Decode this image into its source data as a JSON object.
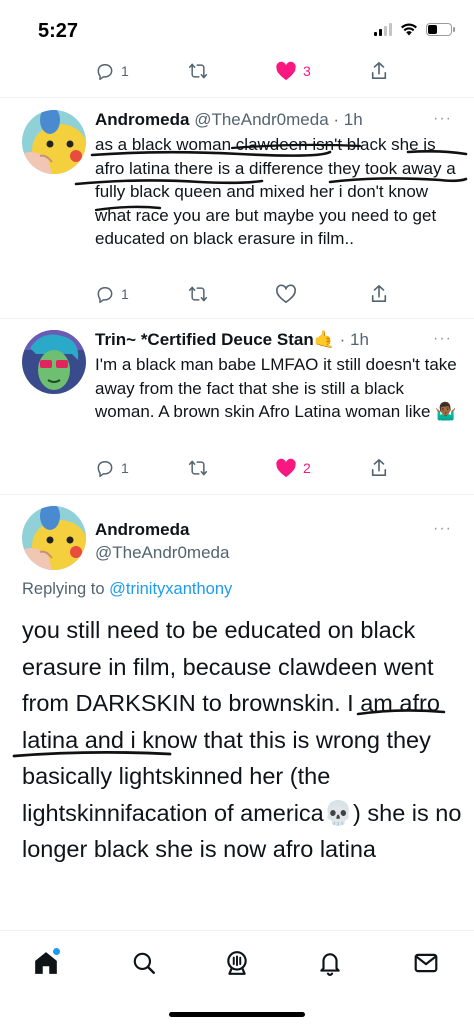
{
  "status_bar": {
    "time": "5:27",
    "icons": [
      "signal-icon",
      "wifi-icon",
      "battery-icon"
    ],
    "battery_level": 0.45
  },
  "top_actions": {
    "reply_count": "1",
    "retweet_count": "",
    "like_count": "3",
    "liked": true
  },
  "tweets": [
    {
      "name": "Andromeda",
      "handle": "@TheAndr0meda",
      "time": "1h",
      "text": "as a black woman clawdeen isn't black she is afro latina there is a difference they took away a fully black queen and mixed her i don't know what race you are but maybe you need to get educated on black erasure in film..",
      "actions": {
        "reply_count": "1",
        "retweet_count": "",
        "like_count": "",
        "liked": false
      }
    },
    {
      "name": "Trin~ *Certified Deuce Stan",
      "name_emoji": "🤙",
      "handle": "",
      "time": "1h",
      "text": "I'm a black man babe LMFAO it still doesn't take away from the fact that she is still a black woman. A brown skin Afro Latina woman like 🤷🏾‍♂️",
      "actions": {
        "reply_count": "1",
        "retweet_count": "",
        "like_count": "2",
        "liked": true
      }
    }
  ],
  "main_tweet": {
    "name": "Andromeda",
    "handle": "@TheAndr0meda",
    "replying_prefix": "Replying to ",
    "replying_to": "@trinityxanthony",
    "text_part1": "you still need to be educated on black erasure in film, because clawdeen went from DARKSKIN to brownskin. I am afro latina and i know that this is wrong they basically lightskinned her (the lightskinnifacation of america",
    "text_emoji": "💀",
    "text_part2": ") she is no longer black she is now afro latina"
  },
  "more_options": "···",
  "bottom_nav": [
    "home-icon",
    "search-icon",
    "spaces-icon",
    "notifications-icon",
    "messages-icon"
  ],
  "colors": {
    "like": "#f91880",
    "link": "#1d9bf0",
    "secondary_text": "#536471",
    "annotation_ink": "#111111"
  }
}
